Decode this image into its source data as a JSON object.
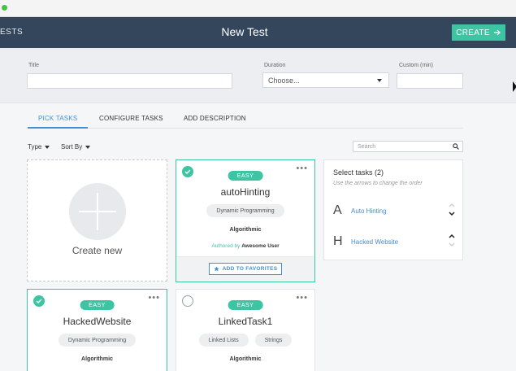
{
  "header": {
    "back_label": "ESTS",
    "title": "New Test",
    "create_label": "CREATE"
  },
  "form": {
    "title_label": "Title",
    "title_value": "",
    "duration_label": "Duration",
    "duration_value": "Choose...",
    "custom_label": "Custom (min)",
    "custom_value": ""
  },
  "tabs": [
    {
      "label": "PICK TASKS",
      "active": true
    },
    {
      "label": "CONFIGURE TASKS",
      "active": false
    },
    {
      "label": "ADD DESCRIPTION",
      "active": false
    }
  ],
  "filters": {
    "type_label": "Type",
    "sort_label": "Sort By",
    "search_placeholder": "Search"
  },
  "create_card": {
    "label": "Create new"
  },
  "cards": [
    {
      "title": "autoHinting",
      "difficulty": "EASY",
      "tags": [
        "Dynamic Programming"
      ],
      "category": "Algorithmic",
      "author_prefix": "Authored by",
      "author_name": "Awesome User",
      "favorite_label": "ADD TO FAVORITES",
      "selected": true
    },
    {
      "title": "HackedWebsite",
      "difficulty": "EASY",
      "tags": [
        "Dynamic Programming"
      ],
      "category": "Algorithmic",
      "selected": true
    },
    {
      "title": "LinkedTask1",
      "difficulty": "EASY",
      "tags": [
        "Linked Lists",
        "Strings"
      ],
      "category": "Algorithmic",
      "selected": false
    }
  ],
  "selected_panel": {
    "title": "Select tasks (2)",
    "hint": "Use the arrows to change the order",
    "items": [
      {
        "letter": "A",
        "name": "Auto Hinting"
      },
      {
        "letter": "H",
        "name": "Hacked Website"
      }
    ]
  },
  "colors": {
    "header_bg": "#34465c",
    "accent_green": "#3dc4a2",
    "link_blue": "#3f8fd9"
  },
  "icons": {
    "create_arrow": "arrow-right-icon",
    "search": "magnifier-icon",
    "favorite": "star-icon",
    "selected": "checkmark-icon",
    "more": "more-dots-icon"
  }
}
